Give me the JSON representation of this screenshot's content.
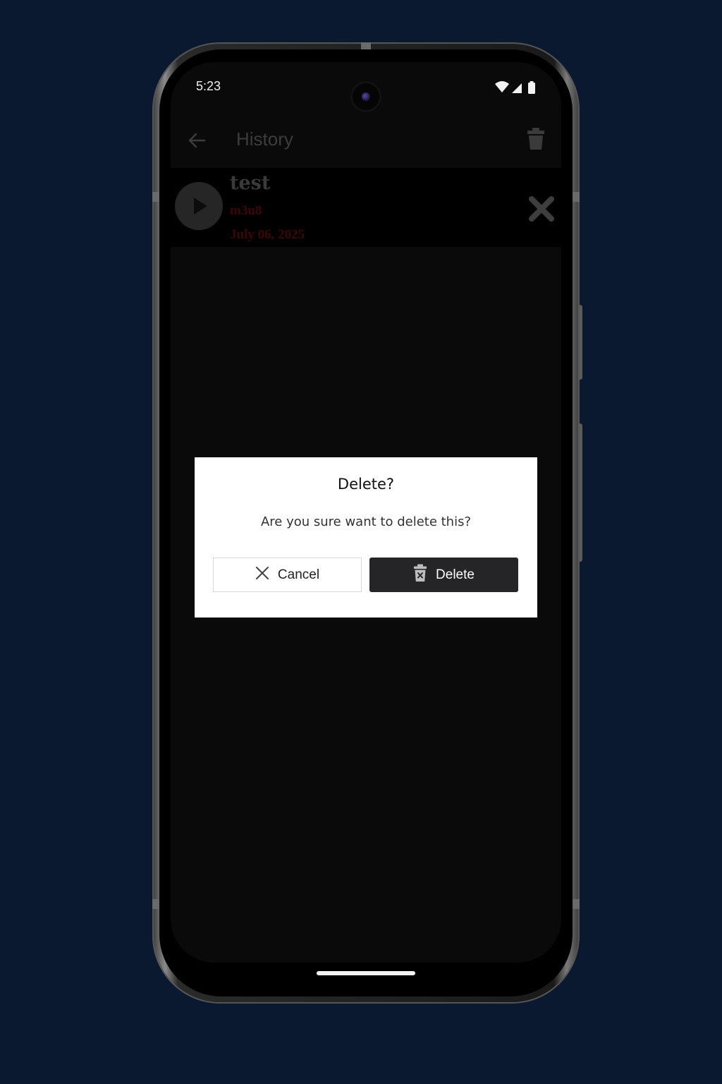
{
  "status_bar": {
    "time": "5:23",
    "icons": [
      "wifi-icon",
      "signal-icon",
      "battery-icon"
    ]
  },
  "app_bar": {
    "title": "History",
    "back_icon": "arrow-left-icon",
    "action_icon": "trash-icon"
  },
  "history": {
    "items": [
      {
        "title": "test",
        "format": "m3u8",
        "date": "July 06, 2025",
        "play_icon": "play-icon",
        "remove_icon": "close-x-icon"
      }
    ]
  },
  "dialog": {
    "title": "Delete?",
    "message": "Are you sure want to delete this?",
    "cancel_label": "Cancel",
    "cancel_icon": "close-icon",
    "delete_label": "Delete",
    "delete_icon": "trash-x-icon"
  },
  "colors": {
    "background": "#0a1830",
    "dialog_bg": "#ffffff",
    "delete_button_bg": "#252528",
    "date_text": "#3d0606"
  }
}
